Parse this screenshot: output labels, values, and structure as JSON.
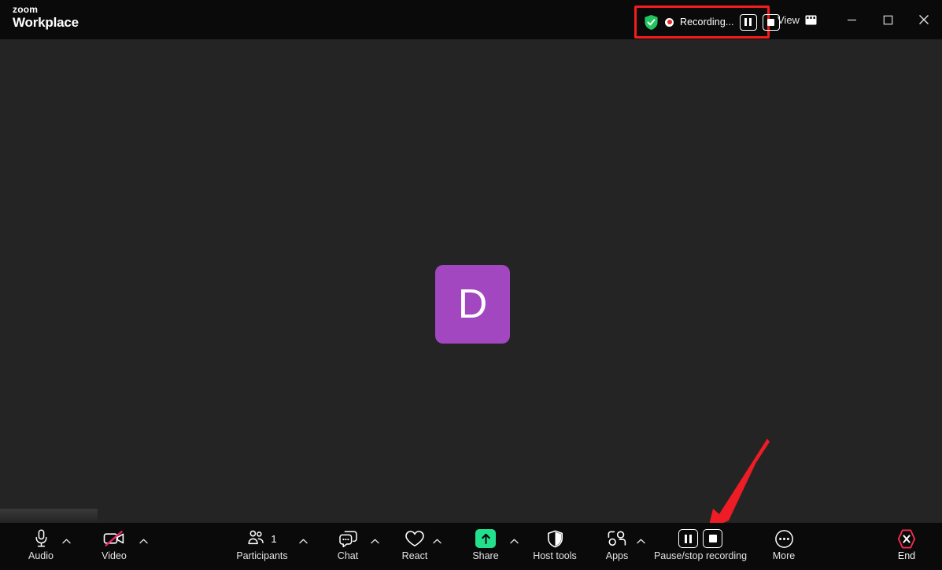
{
  "app": {
    "brand_top": "zoom",
    "brand_bottom": "Workplace"
  },
  "titlebar": {
    "recording": {
      "shield_icon": "shield-check-icon",
      "record_dot_icon": "record-dot-icon",
      "status_text": "Recording...",
      "pause_icon": "pause-icon",
      "stop_icon": "stop-icon",
      "highlight_color": "#f41c1c"
    },
    "view": {
      "label": "View",
      "icon": "layout-grid-icon"
    },
    "window": {
      "minimize_icon": "minimize-icon",
      "maximize_icon": "maximize-icon",
      "close_icon": "close-icon"
    }
  },
  "stage": {
    "avatar": {
      "initial": "D",
      "color": "#a347c0"
    },
    "name_plate": ""
  },
  "annotation": {
    "arrow_icon": "arrow-pointer-icon",
    "arrow_color": "#ee1c25"
  },
  "toolbar": {
    "items": [
      {
        "label": "Audio",
        "icon": "microphone-icon",
        "caret": true
      },
      {
        "label": "Video",
        "icon": "camera-off-icon",
        "caret": true
      },
      {
        "label": "Participants",
        "icon": "participants-icon",
        "caret": true,
        "count": "1"
      },
      {
        "label": "Chat",
        "icon": "chat-bubble-icon",
        "caret": true
      },
      {
        "label": "React",
        "icon": "heart-icon",
        "caret": true
      },
      {
        "label": "Share",
        "icon": "share-screen-icon",
        "caret": true
      },
      {
        "label": "Host tools",
        "icon": "shield-host-icon",
        "caret": false
      },
      {
        "label": "Apps",
        "icon": "apps-icon",
        "caret": true
      },
      {
        "label": "Pause/stop recording",
        "icon": "pause-stop-icon",
        "caret": false
      },
      {
        "label": "More",
        "icon": "more-ellipsis-icon",
        "caret": false
      },
      {
        "label": "End",
        "icon": "end-call-icon",
        "caret": false
      }
    ],
    "colors": {
      "share_accent": "#23e08e",
      "end_accent": "#f32c52",
      "video_off_slash": "#f0246b"
    }
  }
}
